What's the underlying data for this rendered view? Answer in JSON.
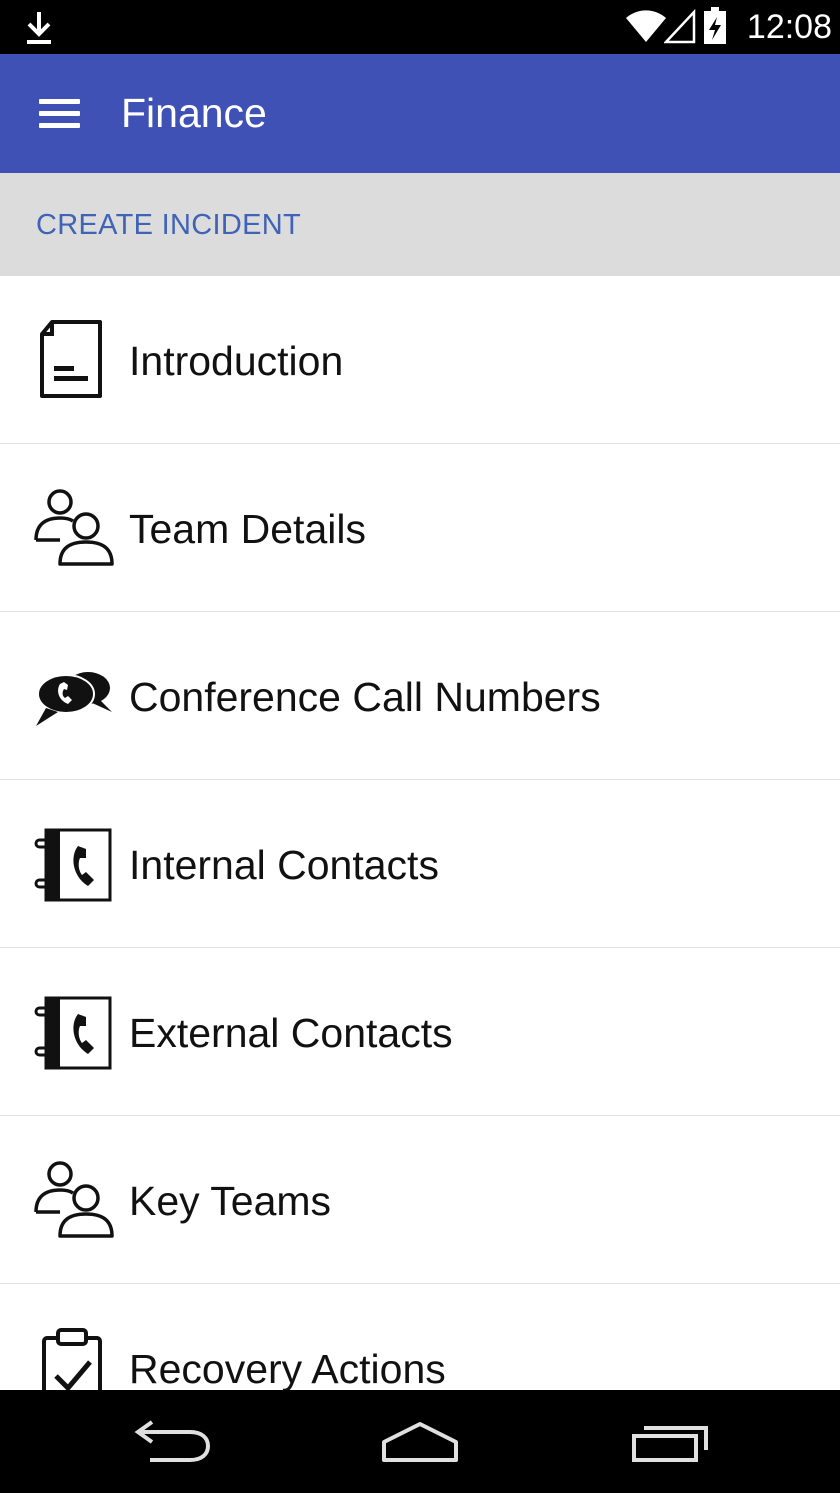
{
  "status_bar": {
    "time": "12:08",
    "icons": [
      "download-icon",
      "wifi-icon",
      "signal-icon",
      "battery-icon"
    ]
  },
  "app_bar": {
    "title": "Finance",
    "menu_icon": "hamburger-menu-icon",
    "background_color": "#3f51b5"
  },
  "section_header": {
    "label": "CREATE INCIDENT",
    "text_color": "#3f63b6",
    "background_color": "#dcdcdc"
  },
  "list": {
    "items": [
      {
        "label": "Introduction",
        "icon": "document-icon"
      },
      {
        "label": "Team Details",
        "icon": "people-icon"
      },
      {
        "label": "Conference Call Numbers",
        "icon": "conference-call-icon"
      },
      {
        "label": "Internal Contacts",
        "icon": "phone-book-icon"
      },
      {
        "label": "External Contacts",
        "icon": "phone-book-icon"
      },
      {
        "label": "Key Teams",
        "icon": "people-icon"
      },
      {
        "label": "Recovery Actions",
        "icon": "clipboard-check-icon"
      }
    ]
  },
  "nav_bar": {
    "buttons": [
      "back-icon",
      "home-icon",
      "recents-icon"
    ]
  }
}
